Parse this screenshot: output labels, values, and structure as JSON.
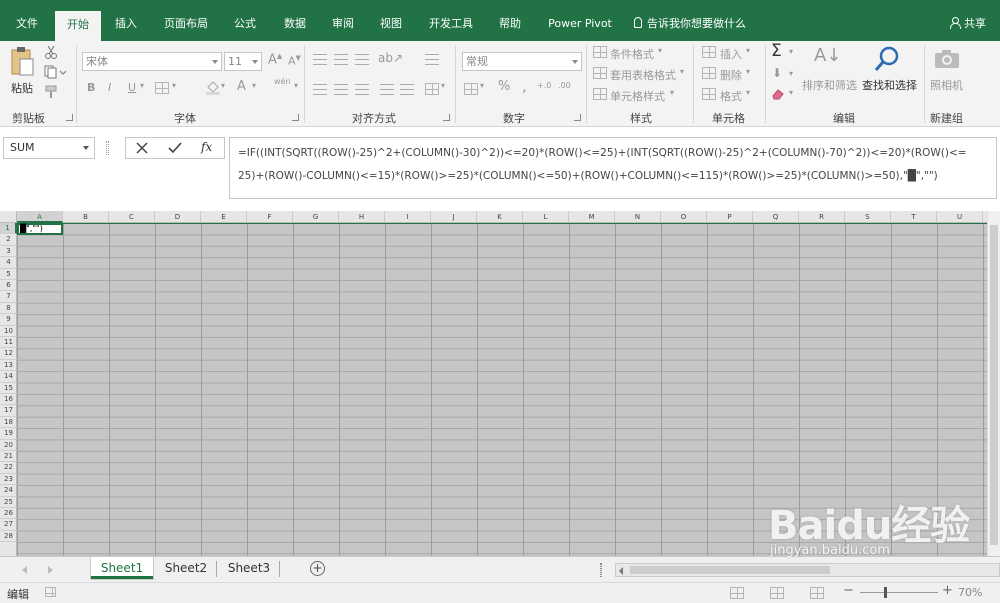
{
  "ribbon_tabs": [
    "文件",
    "开始",
    "插入",
    "页面布局",
    "公式",
    "数据",
    "审阅",
    "视图",
    "开发工具",
    "帮助",
    "Power Pivot"
  ],
  "tell_me": "告诉我你想要做什么",
  "share_label": "共享",
  "clipboard": {
    "paste_label": "粘贴",
    "group_label": "剪贴板"
  },
  "font": {
    "name_value": "宋体",
    "size_value": "11",
    "bold": "B",
    "italic": "I",
    "underline": "U",
    "font_color_letter": "A",
    "phonetic": "wén",
    "group_label": "字体"
  },
  "alignment": {
    "group_label": "对齐方式"
  },
  "number": {
    "format_value": "常规",
    "percent": "%",
    "comma": ",",
    "group_label": "数字"
  },
  "styles": {
    "conditional": "条件格式",
    "table": "套用表格格式",
    "cell_styles": "单元格样式",
    "group_label": "样式"
  },
  "cells": {
    "insert": "插入",
    "delete": "删除",
    "format": "格式",
    "group_label": "单元格"
  },
  "editing": {
    "sort_filter": "排序和筛选",
    "find_select": "查找和选择",
    "group_label": "编辑"
  },
  "new_group": {
    "camera": "照相机",
    "group_label": "新建组"
  },
  "name_box": "SUM",
  "formula_lines": [
    "=IF((INT(SQRT((ROW()-25)^2+(COLUMN()-30)^2))<=20)*(ROW()<=25)+(INT(SQRT((ROW()-25)^2+(COLUMN()-70)^2))<=20)*(ROW()<=",
    "25)+(ROW()-COLUMN()<=15)*(ROW()>=25)*(COLUMN()<=50)+(ROW()+COLUMN()<=115)*(ROW()>=25)*(COLUMN()>=50),\"█\",\"\")"
  ],
  "columns": [
    "A",
    "B",
    "C",
    "D",
    "E",
    "F",
    "G",
    "H",
    "I",
    "J",
    "K",
    "L",
    "M",
    "N",
    "O",
    "P",
    "Q",
    "R",
    "S",
    "T",
    "U"
  ],
  "rows": [
    "1",
    "2",
    "3",
    "4",
    "5",
    "6",
    "7",
    "8",
    "9",
    "10",
    "11",
    "12",
    "13",
    "14",
    "15",
    "16",
    "17",
    "18",
    "19",
    "20",
    "21",
    "22",
    "23",
    "24",
    "25",
    "26",
    "27",
    "28"
  ],
  "cell_a1_text": "█\",\"\")",
  "sheets": [
    "Sheet1",
    "Sheet2",
    "Sheet3"
  ],
  "status_mode": "编辑",
  "zoom": "70%",
  "watermark": {
    "main": "Baidu经验",
    "sub": "jingyan.baidu.com"
  },
  "colors": {
    "excel_green": "#217346",
    "ribbon_bg": "#f3f3f3"
  }
}
